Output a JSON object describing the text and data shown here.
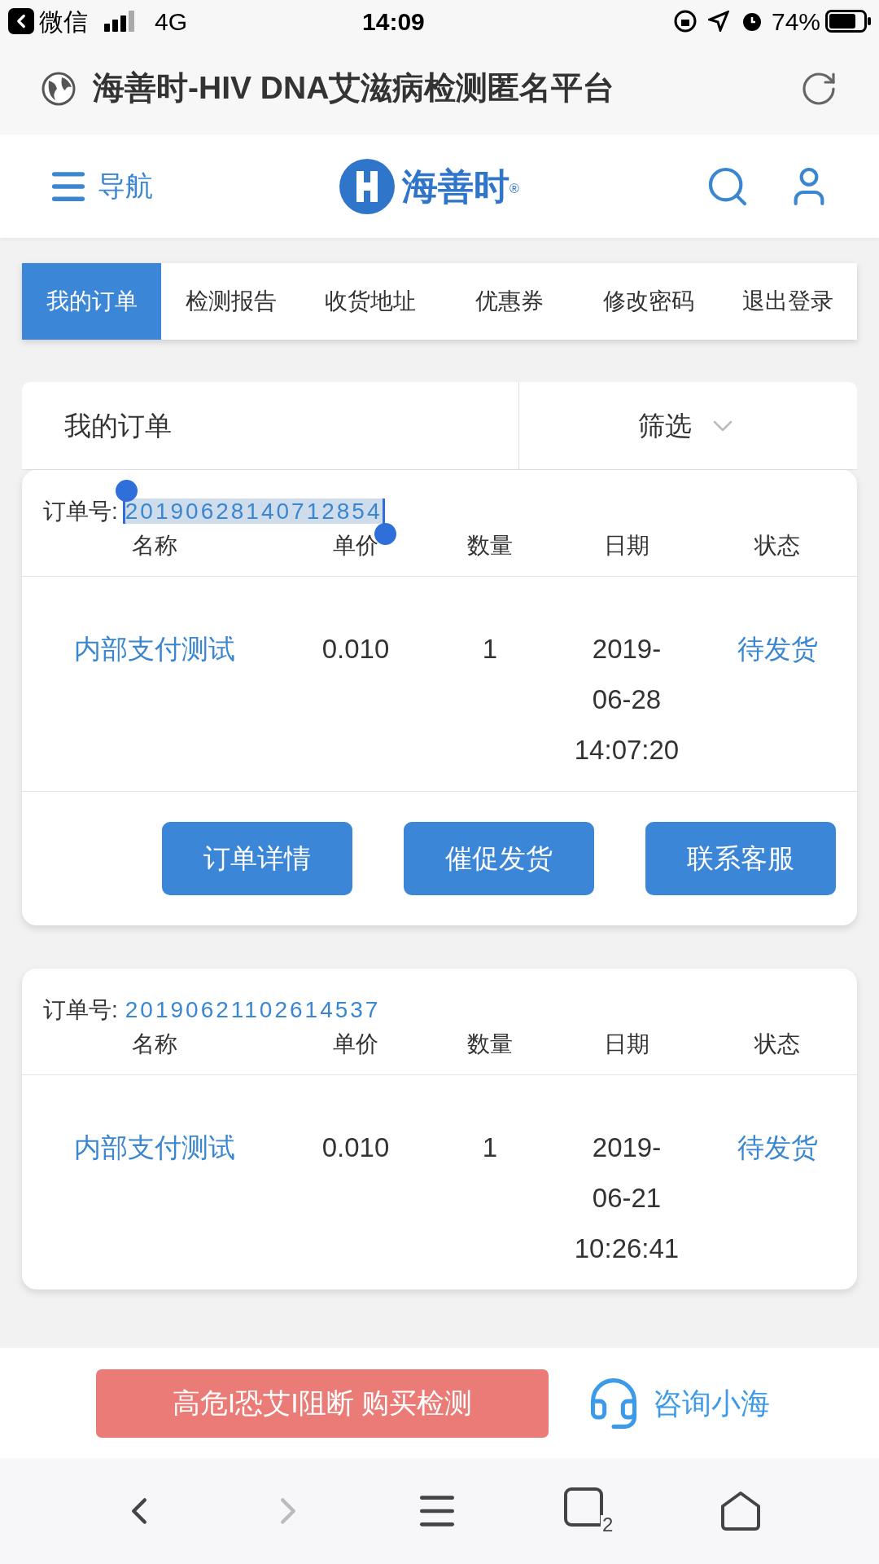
{
  "status_bar": {
    "back_app": "微信",
    "network": "4G",
    "time": "14:09",
    "battery": "74%"
  },
  "browser": {
    "title": "海善时-HIV DNA艾滋病检测匿名平台"
  },
  "header": {
    "nav_label": "导航",
    "logo_text": "海善时",
    "logo_mark": "®"
  },
  "tabs": [
    {
      "label": "我的订单",
      "selected": true
    },
    {
      "label": "检测报告",
      "selected": false
    },
    {
      "label": "收货地址",
      "selected": false
    },
    {
      "label": "优惠券",
      "selected": false
    },
    {
      "label": "修改密码",
      "selected": false
    },
    {
      "label": "退出登录",
      "selected": false
    }
  ],
  "orders_panel": {
    "title": "我的订单",
    "filter": "筛选"
  },
  "orders": [
    {
      "number_label": "订单号:",
      "number": "20190628140712854",
      "number_selected": true,
      "columns": [
        "名称",
        "单价",
        "数量",
        "日期",
        "状态"
      ],
      "name": "内部支付测试",
      "price": "0.010",
      "quantity": "1",
      "date": [
        "2019-",
        "06-28",
        "14:07:20"
      ],
      "status": "待发货",
      "actions": [
        "订单详情",
        "催促发货",
        "联系客服"
      ]
    },
    {
      "number_label": "订单号:",
      "number": "20190621102614537",
      "number_selected": false,
      "columns": [
        "名称",
        "单价",
        "数量",
        "日期",
        "状态"
      ],
      "name": "内部支付测试",
      "price": "0.010",
      "quantity": "1",
      "date": [
        "2019-",
        "06-21",
        "10:26:41"
      ],
      "status": "待发货"
    }
  ],
  "bottom_bar": {
    "buy_button": "高危I恐艾I阻断 购买检测",
    "consult": "咨询小海"
  },
  "browser_toolbar": {
    "tab_count": "2"
  }
}
